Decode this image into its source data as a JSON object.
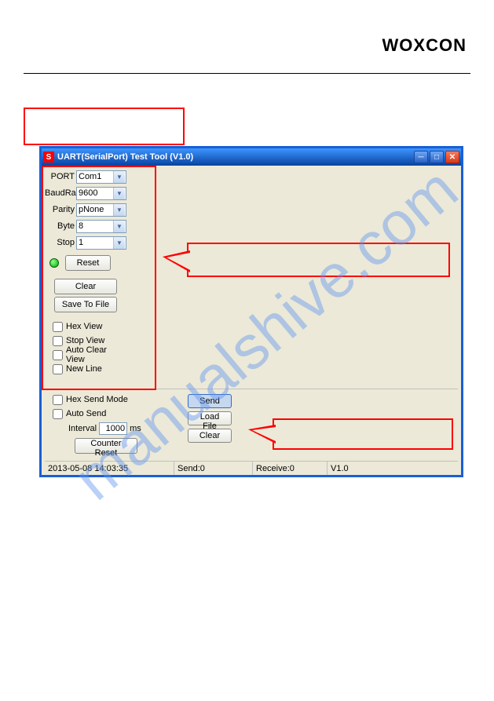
{
  "brand": "WOXCON",
  "window": {
    "title": "UART(SerialPort) Test Tool (V1.0)"
  },
  "port": {
    "port_label": "PORT",
    "port_value": "Com1",
    "baud_label": "BaudRa",
    "baud_value": "9600",
    "parity_label": "Parity",
    "parity_value": "pNone",
    "byte_label": "Byte",
    "byte_value": "8",
    "stop_label": "Stop",
    "stop_value": "1"
  },
  "buttons": {
    "reset": "Reset",
    "clear": "Clear",
    "save": "Save To File",
    "send": "Send",
    "load": "Load File",
    "clear2": "Clear",
    "counter": "Counter Reset"
  },
  "checks": {
    "hex_view": "Hex View",
    "stop_view": "Stop View",
    "auto_clear": "Auto Clear View",
    "new_line": "New Line",
    "hex_send": "Hex Send Mode",
    "auto_send": "Auto Send"
  },
  "interval": {
    "label": "Interval",
    "value": "1000",
    "unit": "ms"
  },
  "status": {
    "time": "2013-05-08 14:03:35",
    "send": "Send:0",
    "receive": "Receive:0",
    "version": "V1.0"
  },
  "watermark": "manualshive.com"
}
